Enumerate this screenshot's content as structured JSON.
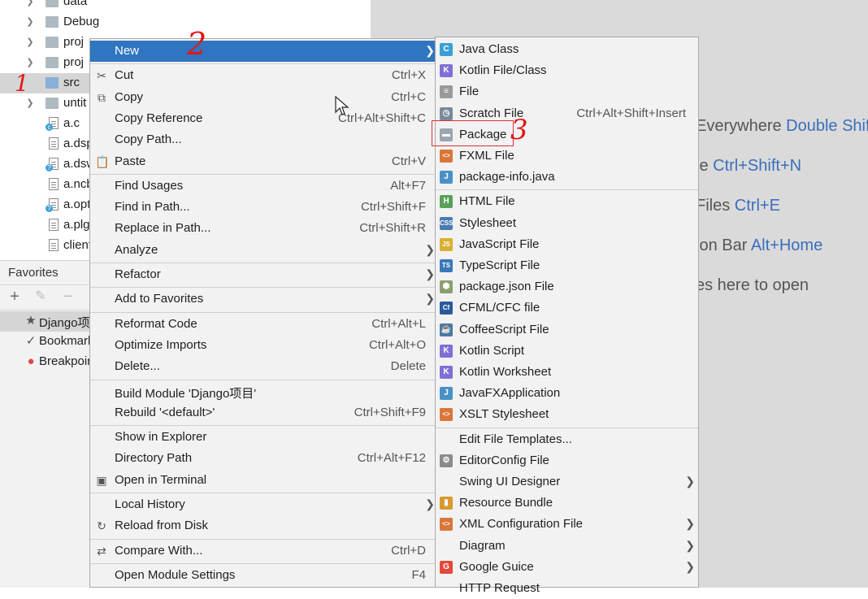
{
  "tree": {
    "items": [
      {
        "label": "data",
        "type": "folder",
        "arrow": true
      },
      {
        "label": "Debug",
        "type": "folder",
        "arrow": true
      },
      {
        "label": "proj",
        "type": "folder",
        "arrow": true
      },
      {
        "label": "proj",
        "type": "folder",
        "arrow": true
      },
      {
        "label": "src",
        "type": "folder-blue",
        "arrow": false,
        "selected": true
      },
      {
        "label": "untit",
        "type": "folder",
        "arrow": true
      },
      {
        "label": "a.c",
        "type": "c-file",
        "arrow": false
      },
      {
        "label": "a.dsp",
        "type": "file",
        "arrow": false
      },
      {
        "label": "a.dsw",
        "type": "file-q",
        "arrow": false
      },
      {
        "label": "a.ncb",
        "type": "file",
        "arrow": false
      },
      {
        "label": "a.opt",
        "type": "file-q",
        "arrow": false
      },
      {
        "label": "a.plg",
        "type": "file",
        "arrow": false
      },
      {
        "label": "client",
        "type": "file",
        "arrow": false
      }
    ]
  },
  "favorites": {
    "title": "Favorites",
    "toolbar": {
      "add": "+",
      "edit": "✎",
      "remove": "−"
    },
    "items": [
      {
        "icon": "★",
        "label": "Django项目",
        "selected": true
      },
      {
        "icon": "✓",
        "label": "Bookmarks"
      },
      {
        "icon": "●",
        "label": "Breakpoints"
      }
    ]
  },
  "editor_hints": [
    {
      "text": "Everywhere ",
      "key": "Double Shift"
    },
    {
      "text": "le ",
      "key": "Ctrl+Shift+N"
    },
    {
      "text": "Files ",
      "key": "Ctrl+E"
    },
    {
      "text": "ion Bar ",
      "key": "Alt+Home"
    },
    {
      "text": "es here to open",
      "key": ""
    }
  ],
  "context_menu": {
    "items": [
      {
        "label": "New",
        "shortcut": "",
        "submenu": true,
        "highlight": true,
        "icon": ""
      },
      {
        "sep": true
      },
      {
        "label": "Cut",
        "shortcut": "Ctrl+X",
        "icon": "✂"
      },
      {
        "label": "Copy",
        "shortcut": "Ctrl+C",
        "icon": "⧉"
      },
      {
        "label": "Copy Reference",
        "shortcut": "Ctrl+Alt+Shift+C",
        "icon": ""
      },
      {
        "label": "Copy Path...",
        "shortcut": "",
        "icon": ""
      },
      {
        "label": "Paste",
        "shortcut": "Ctrl+V",
        "icon": "📋"
      },
      {
        "sep": true
      },
      {
        "label": "Find Usages",
        "shortcut": "Alt+F7",
        "icon": ""
      },
      {
        "label": "Find in Path...",
        "shortcut": "Ctrl+Shift+F",
        "icon": ""
      },
      {
        "label": "Replace in Path...",
        "shortcut": "Ctrl+Shift+R",
        "icon": ""
      },
      {
        "label": "Analyze",
        "shortcut": "",
        "submenu": true,
        "icon": ""
      },
      {
        "sep": true
      },
      {
        "label": "Refactor",
        "shortcut": "",
        "submenu": true,
        "icon": ""
      },
      {
        "sep": true
      },
      {
        "label": "Add to Favorites",
        "shortcut": "",
        "submenu": true,
        "icon": ""
      },
      {
        "sep": true
      },
      {
        "label": "Reformat Code",
        "shortcut": "Ctrl+Alt+L",
        "icon": ""
      },
      {
        "label": "Optimize Imports",
        "shortcut": "Ctrl+Alt+O",
        "icon": ""
      },
      {
        "label": "Delete...",
        "shortcut": "Delete",
        "icon": ""
      },
      {
        "sep": true
      },
      {
        "label": "Build Module 'Django项目'",
        "shortcut": "",
        "icon": ""
      },
      {
        "label": "Rebuild '<default>'",
        "shortcut": "Ctrl+Shift+F9",
        "icon": ""
      },
      {
        "sep": true
      },
      {
        "label": "Show in Explorer",
        "shortcut": "",
        "icon": ""
      },
      {
        "label": "Directory Path",
        "shortcut": "Ctrl+Alt+F12",
        "icon": ""
      },
      {
        "label": "Open in Terminal",
        "shortcut": "",
        "icon": "▣"
      },
      {
        "sep": true
      },
      {
        "label": "Local History",
        "shortcut": "",
        "submenu": true,
        "icon": ""
      },
      {
        "label": "Reload from Disk",
        "shortcut": "",
        "icon": "↻"
      },
      {
        "sep": true
      },
      {
        "label": "Compare With...",
        "shortcut": "Ctrl+D",
        "icon": "⇄"
      },
      {
        "sep": true
      },
      {
        "label": "Open Module Settings",
        "shortcut": "F4",
        "icon": ""
      }
    ]
  },
  "new_submenu": {
    "items": [
      {
        "label": "Java Class",
        "icon_text": "C",
        "icon_color": "#3a9fd6",
        "shortcut": ""
      },
      {
        "label": "Kotlin File/Class",
        "icon_text": "K",
        "icon_color": "#7f6fd6",
        "shortcut": ""
      },
      {
        "label": "File",
        "icon_text": "≡",
        "icon_color": "#9a9a9a",
        "shortcut": ""
      },
      {
        "label": "Scratch File",
        "icon_text": "◷",
        "icon_color": "#7a8a9a",
        "shortcut": "Ctrl+Alt+Shift+Insert"
      },
      {
        "label": "Package",
        "icon_text": "▬",
        "icon_color": "#9aa6ae",
        "shortcut": "",
        "boxed": true
      },
      {
        "label": "FXML File",
        "icon_text": "<>",
        "icon_color": "#d9773a",
        "shortcut": ""
      },
      {
        "label": "package-info.java",
        "icon_text": "J",
        "icon_color": "#4a90c8",
        "shortcut": ""
      },
      {
        "sep": true
      },
      {
        "label": "HTML File",
        "icon_text": "H",
        "icon_color": "#5aa05a",
        "shortcut": ""
      },
      {
        "label": "Stylesheet",
        "icon_text": "CSS",
        "icon_color": "#4a7ab0",
        "shortcut": ""
      },
      {
        "label": "JavaScript File",
        "icon_text": "JS",
        "icon_color": "#d8b030",
        "shortcut": ""
      },
      {
        "label": "TypeScript File",
        "icon_text": "TS",
        "icon_color": "#3a78b8",
        "shortcut": ""
      },
      {
        "label": "package.json File",
        "icon_text": "⬢",
        "icon_color": "#8aa070",
        "shortcut": ""
      },
      {
        "label": "CFML/CFC file",
        "icon_text": "Cf",
        "icon_color": "#2a5a9a",
        "shortcut": ""
      },
      {
        "label": "CoffeeScript File",
        "icon_text": "☕",
        "icon_color": "#4a7aa0",
        "shortcut": ""
      },
      {
        "label": "Kotlin Script",
        "icon_text": "K",
        "icon_color": "#7f6fd6",
        "shortcut": ""
      },
      {
        "label": "Kotlin Worksheet",
        "icon_text": "K",
        "icon_color": "#7f6fd6",
        "shortcut": ""
      },
      {
        "label": "JavaFXApplication",
        "icon_text": "J",
        "icon_color": "#4a90c8",
        "shortcut": ""
      },
      {
        "label": "XSLT Stylesheet",
        "icon_text": "<>",
        "icon_color": "#d9773a",
        "shortcut": ""
      },
      {
        "sep": true
      },
      {
        "label": "Edit File Templates...",
        "icon_text": "",
        "icon_color": "",
        "shortcut": ""
      },
      {
        "label": "EditorConfig File",
        "icon_text": "⚙",
        "icon_color": "#8a8a8a",
        "shortcut": ""
      },
      {
        "label": "Swing UI Designer",
        "icon_text": "",
        "icon_color": "",
        "shortcut": "",
        "submenu": true
      },
      {
        "label": "Resource Bundle",
        "icon_text": "▮",
        "icon_color": "#d89a30",
        "shortcut": ""
      },
      {
        "label": "XML Configuration File",
        "icon_text": "<>",
        "icon_color": "#d9773a",
        "shortcut": "",
        "submenu": true
      },
      {
        "label": "Diagram",
        "icon_text": "",
        "icon_color": "",
        "shortcut": "",
        "submenu": true
      },
      {
        "label": "Google Guice",
        "icon_text": "G",
        "icon_color": "#e04a3a",
        "shortcut": "",
        "submenu": true
      },
      {
        "label": "HTTP Request",
        "icon_text": "",
        "icon_color": "",
        "shortcut": ""
      }
    ]
  },
  "annotations": {
    "one": "1",
    "two": "2",
    "three": "3"
  }
}
